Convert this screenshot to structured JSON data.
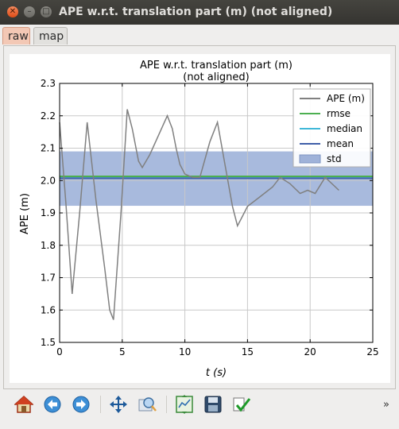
{
  "window": {
    "title": "APE w.r.t. translation part (m) (not aligned)"
  },
  "tabs": [
    {
      "label": "raw"
    },
    {
      "label": "map"
    }
  ],
  "chart_data": {
    "type": "line",
    "title": "APE w.r.t. translation part (m)",
    "subtitle": "(not aligned)",
    "xlabel": "t (s)",
    "ylabel": "APE (m)",
    "xlim": [
      0,
      25
    ],
    "ylim": [
      1.5,
      2.3
    ],
    "xticks": [
      0,
      5,
      10,
      15,
      20,
      25
    ],
    "yticks": [
      1.5,
      1.6,
      1.7,
      1.8,
      1.9,
      2.0,
      2.1,
      2.2,
      2.3
    ],
    "grid": true,
    "legend_position": "top-right",
    "series": [
      {
        "name": "APE (m)",
        "color": "#808080",
        "x": [
          0,
          0.5,
          1.0,
          1.6,
          2.2,
          2.9,
          3.6,
          4.0,
          4.3,
          4.9,
          5.4,
          5.8,
          6.3,
          6.6,
          7.2,
          7.9,
          8.6,
          9.0,
          9.3,
          9.6,
          10.0,
          10.6,
          11.2,
          12.0,
          12.6,
          13.2,
          13.8,
          14.2,
          14.6,
          15.0,
          16.0,
          17.0,
          17.6,
          18.4,
          19.2,
          19.8,
          20.4,
          21.2,
          22.3
        ],
        "y": [
          2.18,
          1.93,
          1.65,
          1.9,
          2.18,
          1.94,
          1.73,
          1.6,
          1.57,
          1.9,
          2.22,
          2.16,
          2.06,
          2.04,
          2.08,
          2.14,
          2.2,
          2.16,
          2.1,
          2.05,
          2.02,
          2.01,
          2.01,
          2.12,
          2.18,
          2.05,
          1.92,
          1.86,
          1.89,
          1.92,
          1.95,
          1.98,
          2.01,
          1.99,
          1.96,
          1.97,
          1.96,
          2.01,
          1.97
        ]
      },
      {
        "name": "rmse",
        "color": "#4caf50",
        "value": 2.013
      },
      {
        "name": "median",
        "color": "#3fb8d8",
        "value": 2.012
      },
      {
        "name": "mean",
        "color": "#3f5ea8",
        "value": 2.007
      },
      {
        "name": "std",
        "color": "#9fb2d9",
        "range": [
          1.922,
          2.09
        ]
      }
    ]
  },
  "toolbar": {
    "items": [
      {
        "icon": "home-icon"
      },
      {
        "icon": "back-arrow-icon"
      },
      {
        "icon": "forward-arrow-icon"
      },
      {
        "icon": "pan-icon"
      },
      {
        "icon": "zoom-icon"
      },
      {
        "icon": "configure-subplots-icon"
      },
      {
        "icon": "save-icon"
      },
      {
        "icon": "edit-check-icon"
      }
    ],
    "more": "»"
  }
}
